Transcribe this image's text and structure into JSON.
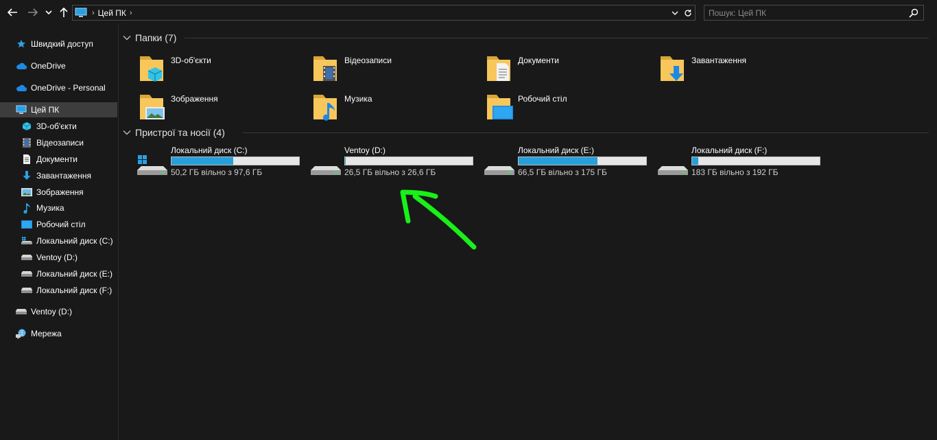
{
  "address_bar": {
    "location": "Цей ПК"
  },
  "search": {
    "placeholder": "Пошук: Цей ПК"
  },
  "sidebar": {
    "items": [
      {
        "label": "Швидкий доступ",
        "icon": "star-icon"
      },
      {
        "label": "OneDrive",
        "icon": "cloud-icon"
      },
      {
        "label": "OneDrive - Personal",
        "icon": "cloud-icon"
      },
      {
        "label": "Цей ПК",
        "icon": "computer-icon",
        "selected": true
      },
      {
        "label": "3D-об'єкти",
        "icon": "cube-icon"
      },
      {
        "label": "Відеозаписи",
        "icon": "film-icon"
      },
      {
        "label": "Документи",
        "icon": "document-icon"
      },
      {
        "label": "Завантаження",
        "icon": "download-arrow-icon"
      },
      {
        "label": "Зображення",
        "icon": "picture-icon"
      },
      {
        "label": "Музика",
        "icon": "music-note-icon"
      },
      {
        "label": "Робочий стіл",
        "icon": "desktop-icon"
      },
      {
        "label": "Локальний диск (C:)",
        "icon": "windows-drive-icon"
      },
      {
        "label": "Ventoy (D:)",
        "icon": "drive-icon"
      },
      {
        "label": "Локальний диск (E:)",
        "icon": "drive-icon"
      },
      {
        "label": "Локальний диск (F:)",
        "icon": "drive-icon"
      },
      {
        "label": "Ventoy (D:)",
        "icon": "drive-icon"
      },
      {
        "label": "Мережа",
        "icon": "network-icon"
      }
    ]
  },
  "folders_group": {
    "title": "Папки (7)",
    "items": [
      {
        "label": "3D-об'єкти",
        "icon": "folder-3d-objects-icon"
      },
      {
        "label": "Відеозаписи",
        "icon": "folder-videos-icon"
      },
      {
        "label": "Документи",
        "icon": "folder-documents-icon"
      },
      {
        "label": "Завантаження",
        "icon": "folder-downloads-icon"
      },
      {
        "label": "Зображення",
        "icon": "folder-pictures-icon"
      },
      {
        "label": "Музика",
        "icon": "folder-music-icon"
      },
      {
        "label": "Робочий стіл",
        "icon": "folder-desktop-icon"
      }
    ]
  },
  "devices_group": {
    "title": "Пристрої та носії (4)",
    "items": [
      {
        "label": "Локальний диск (C:)",
        "free_text": "50,2 ГБ вільно з 97,6 ГБ",
        "used_fraction": 0.486,
        "icon": "windows-drive-icon"
      },
      {
        "label": "Ventoy (D:)",
        "free_text": "26,5 ГБ вільно з 26,6 ГБ",
        "used_fraction": 0.004,
        "icon": "drive-icon"
      },
      {
        "label": "Локальний диск (E:)",
        "free_text": "66,5 ГБ вільно з 175 ГБ",
        "used_fraction": 0.62,
        "icon": "drive-icon"
      },
      {
        "label": "Локальний диск (F:)",
        "free_text": "183 ГБ вільно з 192 ГБ",
        "used_fraction": 0.047,
        "icon": "drive-icon"
      }
    ]
  },
  "colors": {
    "background": "#191919",
    "usage_bar": "#26a0da",
    "annotation_arrow": "#19f019",
    "folder": "#f7c75c"
  }
}
